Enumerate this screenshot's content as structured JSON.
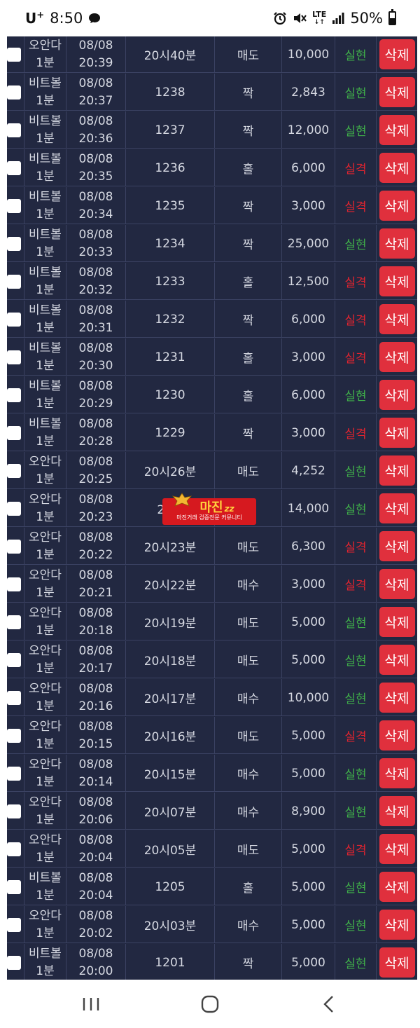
{
  "status_bar": {
    "carrier": "U",
    "carrier_sup": "+",
    "time": "8:50",
    "network": "LTE",
    "battery": "50%"
  },
  "colors": {
    "table_bg": "#222841",
    "win": "#3fae49",
    "lose": "#e0242f",
    "delete_button": "#e0303d"
  },
  "delete_label": "삭제",
  "watermark": {
    "logo": "마진",
    "logo_suffix": "zz",
    "subtitle": "마진거래 검증전문 커뮤니티"
  },
  "rows": [
    {
      "game": [
        "오안다",
        "1분"
      ],
      "date": "08/08",
      "time": "20:39",
      "round": "20시40분",
      "pick": "매도",
      "amount": "10,000",
      "result": "실현",
      "status": "win"
    },
    {
      "game": [
        "비트볼",
        "1분"
      ],
      "date": "08/08",
      "time": "20:37",
      "round": "1238",
      "pick": "짝",
      "amount": "2,843",
      "result": "실현",
      "status": "win"
    },
    {
      "game": [
        "비트볼",
        "1분"
      ],
      "date": "08/08",
      "time": "20:36",
      "round": "1237",
      "pick": "짝",
      "amount": "12,000",
      "result": "실현",
      "status": "win"
    },
    {
      "game": [
        "비트볼",
        "1분"
      ],
      "date": "08/08",
      "time": "20:35",
      "round": "1236",
      "pick": "홀",
      "amount": "6,000",
      "result": "실격",
      "status": "lose"
    },
    {
      "game": [
        "비트볼",
        "1분"
      ],
      "date": "08/08",
      "time": "20:34",
      "round": "1235",
      "pick": "짝",
      "amount": "3,000",
      "result": "실격",
      "status": "lose"
    },
    {
      "game": [
        "비트볼",
        "1분"
      ],
      "date": "08/08",
      "time": "20:33",
      "round": "1234",
      "pick": "짝",
      "amount": "25,000",
      "result": "실현",
      "status": "win"
    },
    {
      "game": [
        "비트볼",
        "1분"
      ],
      "date": "08/08",
      "time": "20:32",
      "round": "1233",
      "pick": "홀",
      "amount": "12,500",
      "result": "실격",
      "status": "lose"
    },
    {
      "game": [
        "비트볼",
        "1분"
      ],
      "date": "08/08",
      "time": "20:31",
      "round": "1232",
      "pick": "짝",
      "amount": "6,000",
      "result": "실격",
      "status": "lose"
    },
    {
      "game": [
        "비트볼",
        "1분"
      ],
      "date": "08/08",
      "time": "20:30",
      "round": "1231",
      "pick": "홀",
      "amount": "3,000",
      "result": "실격",
      "status": "lose"
    },
    {
      "game": [
        "비트볼",
        "1분"
      ],
      "date": "08/08",
      "time": "20:29",
      "round": "1230",
      "pick": "홀",
      "amount": "6,000",
      "result": "실현",
      "status": "win"
    },
    {
      "game": [
        "비트볼",
        "1분"
      ],
      "date": "08/08",
      "time": "20:28",
      "round": "1229",
      "pick": "짝",
      "amount": "3,000",
      "result": "실격",
      "status": "lose"
    },
    {
      "game": [
        "오안다",
        "1분"
      ],
      "date": "08/08",
      "time": "20:25",
      "round": "20시26분",
      "pick": "매도",
      "amount": "4,252",
      "result": "실현",
      "status": "win"
    },
    {
      "game": [
        "오안다",
        "1분"
      ],
      "date": "08/08",
      "time": "20:23",
      "round": "20시",
      "pick": "도",
      "amount": "14,000",
      "result": "실현",
      "status": "win"
    },
    {
      "game": [
        "오안다",
        "1분"
      ],
      "date": "08/08",
      "time": "20:22",
      "round": "20시23분",
      "pick": "매도",
      "amount": "6,300",
      "result": "실격",
      "status": "lose"
    },
    {
      "game": [
        "오안다",
        "1분"
      ],
      "date": "08/08",
      "time": "20:21",
      "round": "20시22분",
      "pick": "매수",
      "amount": "3,000",
      "result": "실격",
      "status": "lose"
    },
    {
      "game": [
        "오안다",
        "1분"
      ],
      "date": "08/08",
      "time": "20:18",
      "round": "20시19분",
      "pick": "매도",
      "amount": "5,000",
      "result": "실현",
      "status": "win"
    },
    {
      "game": [
        "오안다",
        "1분"
      ],
      "date": "08/08",
      "time": "20:17",
      "round": "20시18분",
      "pick": "매도",
      "amount": "5,000",
      "result": "실현",
      "status": "win"
    },
    {
      "game": [
        "오안다",
        "1분"
      ],
      "date": "08/08",
      "time": "20:16",
      "round": "20시17분",
      "pick": "매수",
      "amount": "10,000",
      "result": "실현",
      "status": "win"
    },
    {
      "game": [
        "오안다",
        "1분"
      ],
      "date": "08/08",
      "time": "20:15",
      "round": "20시16분",
      "pick": "매도",
      "amount": "5,000",
      "result": "실격",
      "status": "lose"
    },
    {
      "game": [
        "오안다",
        "1분"
      ],
      "date": "08/08",
      "time": "20:14",
      "round": "20시15분",
      "pick": "매수",
      "amount": "5,000",
      "result": "실현",
      "status": "win"
    },
    {
      "game": [
        "오안다",
        "1분"
      ],
      "date": "08/08",
      "time": "20:06",
      "round": "20시07분",
      "pick": "매수",
      "amount": "8,900",
      "result": "실현",
      "status": "win"
    },
    {
      "game": [
        "오안다",
        "1분"
      ],
      "date": "08/08",
      "time": "20:04",
      "round": "20시05분",
      "pick": "매도",
      "amount": "5,000",
      "result": "실격",
      "status": "lose"
    },
    {
      "game": [
        "비트볼",
        "1분"
      ],
      "date": "08/08",
      "time": "20:04",
      "round": "1205",
      "pick": "홀",
      "amount": "5,000",
      "result": "실현",
      "status": "win"
    },
    {
      "game": [
        "오안다",
        "1분"
      ],
      "date": "08/08",
      "time": "20:02",
      "round": "20시03분",
      "pick": "매수",
      "amount": "5,000",
      "result": "실현",
      "status": "win"
    },
    {
      "game": [
        "비트볼",
        "1분"
      ],
      "date": "08/08",
      "time": "20:00",
      "round": "1201",
      "pick": "짝",
      "amount": "5,000",
      "result": "실현",
      "status": "win"
    }
  ]
}
